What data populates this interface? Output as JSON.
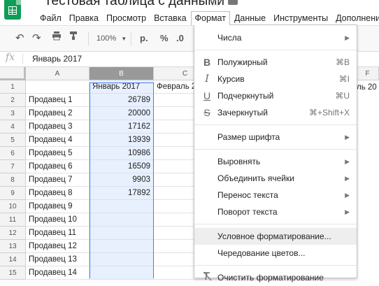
{
  "title": "Тестовая таблица с данными",
  "menu": [
    "Файл",
    "Правка",
    "Просмотр",
    "Вставка",
    "Формат",
    "Данные",
    "Инструменты",
    "Дополнени"
  ],
  "toolbar": {
    "zoom": "100%",
    "currency": "р.",
    "percent": "%",
    "decimal": ".0"
  },
  "formula_bar": {
    "fx": "fx",
    "value": "Январь 2017"
  },
  "columns": [
    "A",
    "B",
    "C",
    "F"
  ],
  "rows": [
    "1",
    "2",
    "3",
    "4",
    "5",
    "6",
    "7",
    "8",
    "9",
    "10",
    "11",
    "12",
    "13",
    "14",
    "15"
  ],
  "table": [
    [
      "",
      "Январь 2017",
      "Февраль 2"
    ],
    [
      "Продавец 1",
      "26789"
    ],
    [
      "Продавец 2",
      "20000"
    ],
    [
      "Продавец 3",
      "17162"
    ],
    [
      "Продавец 4",
      "13939"
    ],
    [
      "Продавец 5",
      "10986"
    ],
    [
      "Продавец 6",
      "16509"
    ],
    [
      "Продавец 7",
      "9903"
    ],
    [
      "Продавец 8",
      "17892"
    ],
    [
      "Продавец 9",
      ""
    ],
    [
      "Продавец 10",
      ""
    ],
    [
      "Продавец 11",
      ""
    ],
    [
      "Продавец 12",
      ""
    ],
    [
      "Продавец 13",
      ""
    ],
    [
      "Продавец 14",
      ""
    ]
  ],
  "row1_f": "ль 20",
  "format_menu": {
    "numbers": "Числа",
    "bold": {
      "label": "Полужирный",
      "shortcut": "⌘B",
      "icon": "B"
    },
    "italic": {
      "label": "Курсив",
      "shortcut": "⌘I",
      "icon": "I"
    },
    "underline": {
      "label": "Подчеркнутый",
      "shortcut": "⌘U",
      "icon": "U"
    },
    "strike": {
      "label": "Зачеркнутый",
      "shortcut": "⌘+Shift+X",
      "icon": "S"
    },
    "font_size": "Размер шрифта",
    "align": "Выровнять",
    "merge": "Объединить ячейки",
    "wrap": "Перенос текста",
    "rotate": "Поворот текста",
    "conditional": "Условное форматирование...",
    "alternating": "Чередование цветов...",
    "clear": "Очистить форматирование"
  }
}
